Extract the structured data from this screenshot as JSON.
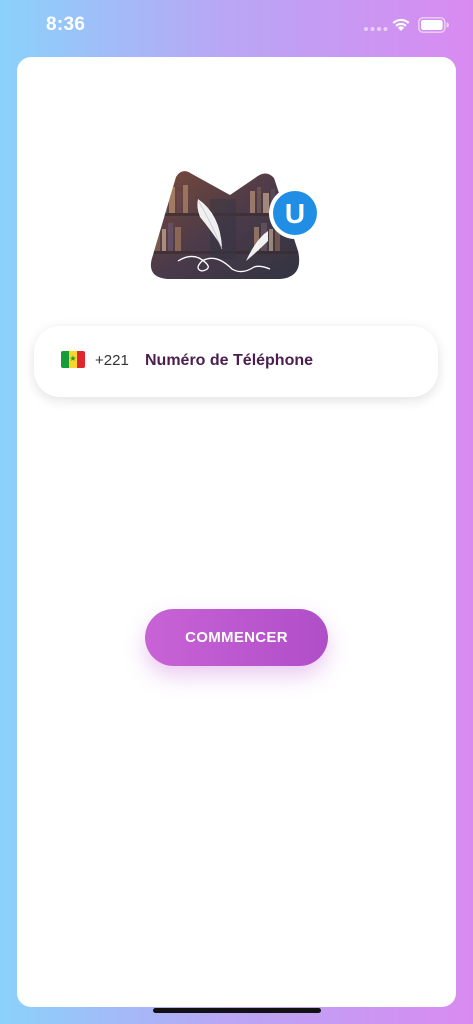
{
  "status_bar": {
    "time": "8:36",
    "icons": [
      "signal-dots-icon",
      "wifi-icon",
      "battery-icon"
    ]
  },
  "logo": {
    "badge_letter": "U",
    "badge_color": "#1f8ee4"
  },
  "phone": {
    "country_flag": "senegal-flag-icon",
    "dial_code": "+221",
    "placeholder": "Numéro de Téléphone",
    "value": ""
  },
  "actions": {
    "start_label": "COMMENCER"
  },
  "colors": {
    "accent_start": "#c863d6",
    "accent_end": "#b04ec8",
    "placeholder_text": "#4a1f4e"
  }
}
